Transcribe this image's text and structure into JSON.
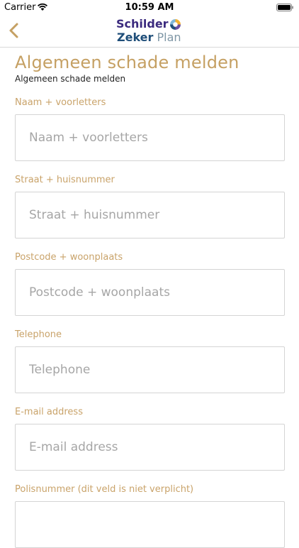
{
  "status_bar": {
    "carrier": "Carrier",
    "time": "10:59 AM"
  },
  "nav": {
    "back_icon": "chevron-left-icon",
    "logo": {
      "line1": "Schilder",
      "zeker": "Zeker",
      "plan": "Plan"
    }
  },
  "page": {
    "title": "Algemeen schade melden",
    "subtitle": "Algemeen schade melden"
  },
  "form": {
    "fields": [
      {
        "label": "Naam + voorletters",
        "placeholder": "Naam + voorletters",
        "value": ""
      },
      {
        "label": "Straat + huisnummer",
        "placeholder": "Straat + huisnummer",
        "value": ""
      },
      {
        "label": "Postcode + woonplaats",
        "placeholder": "Postcode + woonplaats",
        "value": ""
      },
      {
        "label": "Telephone",
        "placeholder": "Telephone",
        "value": ""
      },
      {
        "label": "E-mail address",
        "placeholder": "E-mail address",
        "value": ""
      },
      {
        "label": "Polisnummer (dit veld is niet verplicht)",
        "placeholder": "",
        "value": ""
      }
    ]
  },
  "colors": {
    "accent": "#c5a063",
    "logo_purple": "#3b2a7e",
    "logo_blue": "#1f4e79",
    "logo_grey": "#7f97a6",
    "border": "#d4d4d4"
  }
}
